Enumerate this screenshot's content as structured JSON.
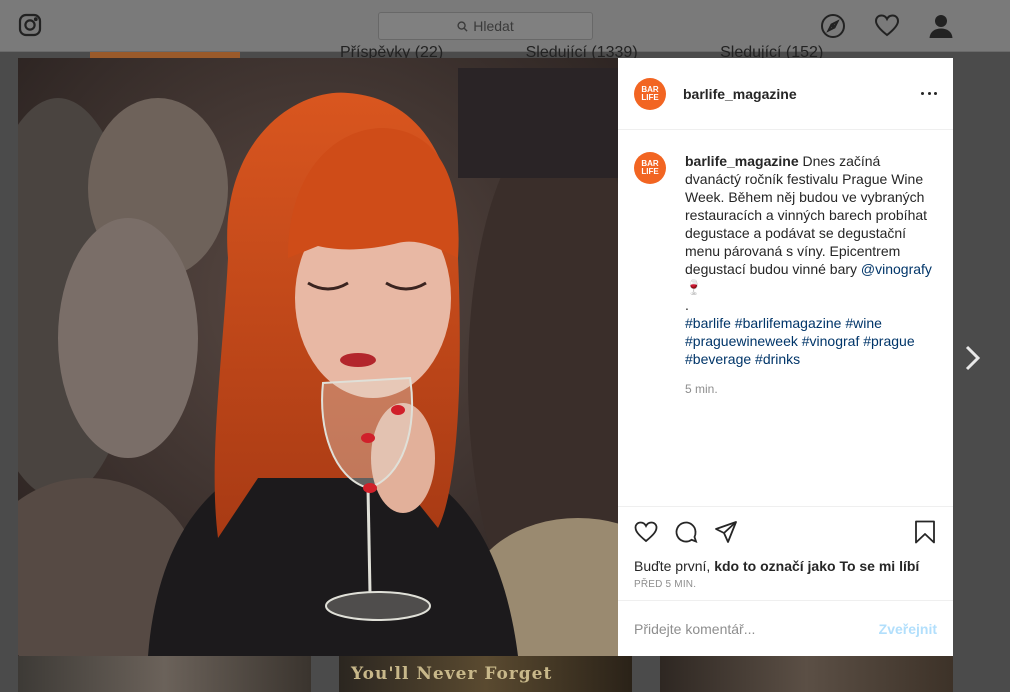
{
  "topbar": {
    "search_placeholder": "Hledat"
  },
  "background_profile": {
    "stats": [
      "Příspěvky (22)",
      "Sledující (1339)",
      "Sledující (152)"
    ],
    "thumb_text": "You'll Never Forget"
  },
  "post": {
    "username": "barlife_magazine",
    "avatar_text": "BAR LIFE",
    "caption_text": "Dnes začíná dvanáctý ročník festivalu Prague Wine Week. Během něj budou ve vybraných restauracích a vinných barech probíhat degustace a podávat se degustační menu párovaná s víny. Epicentrem degustací budou vinné bary",
    "mention": "@vinografy",
    "wine_emoji": "🍷",
    "dot": ".",
    "hashtags": "#barlife #barlifemagazine #wine #praguewineweek #vinograf #prague #beverage #drinks",
    "caption_time": "5 min.",
    "likes_prefix": "Buďte první,",
    "likes_bold": "kdo to označí jako To se mi líbí",
    "date": "PŘED 5 MIN.",
    "comment_placeholder": "Přidejte komentář...",
    "publish_label": "Zveřejnit"
  },
  "colors": {
    "brand_orange": "#f26522",
    "link": "#003569",
    "publish_disabled": "#b2dffc"
  }
}
